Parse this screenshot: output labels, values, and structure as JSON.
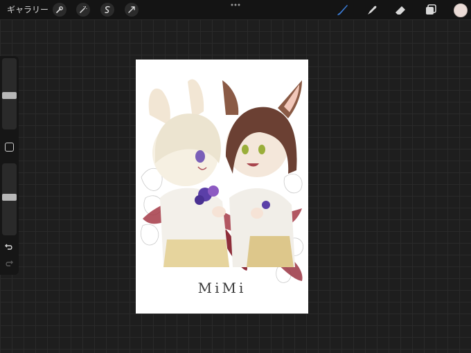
{
  "topbar": {
    "gallery_label": "ギャラリー",
    "left_tools": [
      {
        "icon": "wrench-icon"
      },
      {
        "icon": "magic-wand-icon"
      },
      {
        "icon": "selection-icon"
      },
      {
        "icon": "transform-arrow-icon"
      }
    ],
    "right_tools": [
      {
        "icon": "brush-icon",
        "active": true
      },
      {
        "icon": "smudge-icon"
      },
      {
        "icon": "eraser-icon"
      },
      {
        "icon": "layers-icon"
      }
    ],
    "current_color": "#eadbd6",
    "active_tool_color": "#3a7bd5"
  },
  "sidebar": {
    "brush_size_level": 0.47,
    "opacity_level": 0.53
  },
  "canvas": {
    "signature_text": "MiMi"
  }
}
